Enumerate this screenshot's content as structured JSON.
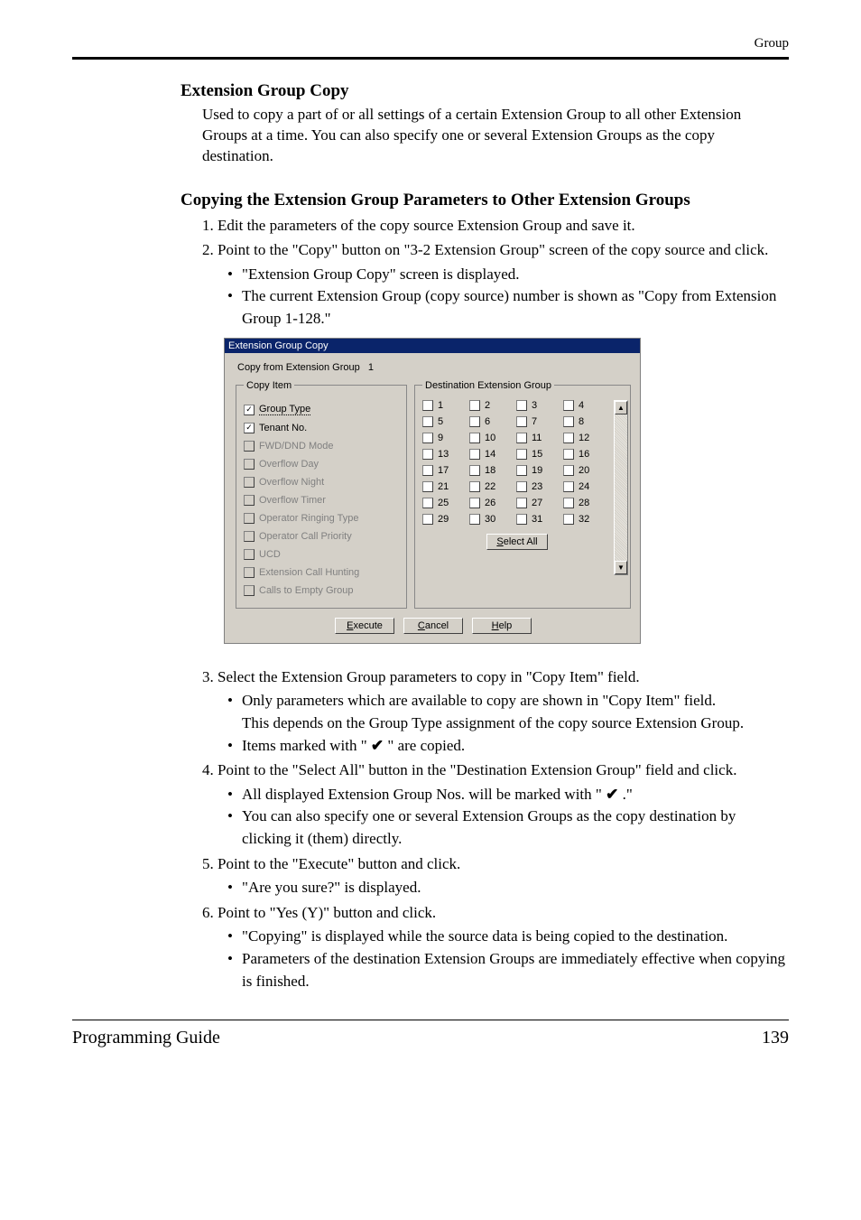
{
  "page": {
    "header_right": "Group",
    "footer_left": "Programming Guide",
    "footer_right": "139"
  },
  "section": {
    "title": "Extension Group Copy",
    "desc": "Used to copy a part of or all settings of a certain Extension Group to all other Extension Groups at a time. You can also specify one or several Extension Groups as the copy destination.",
    "title2": "Copying the Extension Group Parameters to Other Extension Groups",
    "step1": "1. Edit the parameters of the copy source Extension Group and save it.",
    "step2": "2. Point to the \"Copy\" button on \"3-2 Extension Group\" screen of the copy source and click.",
    "step2_b1": "\"Extension Group Copy\" screen is displayed.",
    "step2_b2": "The current Extension Group (copy source) number is shown as \"Copy from Extension Group 1-128.\"",
    "step3": "3. Select the Extension Group parameters to copy in \"Copy Item\" field.",
    "step3_b1a": "Only parameters which are available to copy are shown in \"Copy Item\" field.",
    "step3_b1b": "This depends on the Group Type assignment of the copy source Extension Group.",
    "step3_b2a": "Items marked with \" ",
    "step3_b2c": " \" are copied.",
    "step4": "4. Point to the \"Select All\" button in the \"Destination Extension Group\" field and click.",
    "step4_b1a": "All displayed Extension Group Nos. will be marked with \" ",
    "step4_b1c": " .\"",
    "step4_b2": "You can also specify one or several Extension Groups as the copy destination by clicking it (them) directly.",
    "step5": "5. Point to the \"Execute\" button and click.",
    "step5_b1": "\"Are you sure?\" is displayed.",
    "step6": "6. Point to \"Yes (Y)\" button and click.",
    "step6_b1": "\"Copying\" is displayed while the source data is being copied to the destination.",
    "step6_b2": "Parameters of the destination Extension Groups are immediately effective when copying is finished.",
    "checkmark": "✔"
  },
  "dialog": {
    "title": "Extension Group Copy",
    "copy_from_label": "Copy from Extension Group",
    "copy_from_num": "1",
    "copy_item_legend": "Copy Item",
    "dest_legend": "Destination Extension Group",
    "items": [
      {
        "label": "Group Type",
        "checked": true,
        "enabled": true,
        "focused": true
      },
      {
        "label": "Tenant No.",
        "checked": true,
        "enabled": true
      },
      {
        "label": "FWD/DND Mode",
        "checked": false,
        "enabled": false
      },
      {
        "label": "Overflow Day",
        "checked": false,
        "enabled": false
      },
      {
        "label": "Overflow Night",
        "checked": false,
        "enabled": false
      },
      {
        "label": "Overflow Timer",
        "checked": false,
        "enabled": false
      },
      {
        "label": "Operator Ringing Type",
        "checked": false,
        "enabled": false
      },
      {
        "label": "Operator Call Priority",
        "checked": false,
        "enabled": false
      },
      {
        "label": "UCD",
        "checked": false,
        "enabled": false
      },
      {
        "label": "Extension Call Hunting",
        "checked": false,
        "enabled": false
      },
      {
        "label": "Calls to Empty Group",
        "checked": false,
        "enabled": false
      }
    ],
    "dest_numbers": [
      1,
      2,
      3,
      4,
      5,
      6,
      7,
      8,
      9,
      10,
      11,
      12,
      13,
      14,
      15,
      16,
      17,
      18,
      19,
      20,
      21,
      22,
      23,
      24,
      25,
      26,
      27,
      28,
      29,
      30,
      31,
      32
    ],
    "btn_select_all": "Select All",
    "btn_select_all_ul": "S",
    "btn_execute": "Execute",
    "btn_execute_ul": "E",
    "btn_cancel": "Cancel",
    "btn_cancel_ul": "C",
    "btn_help": "Help",
    "btn_help_ul": "H"
  }
}
